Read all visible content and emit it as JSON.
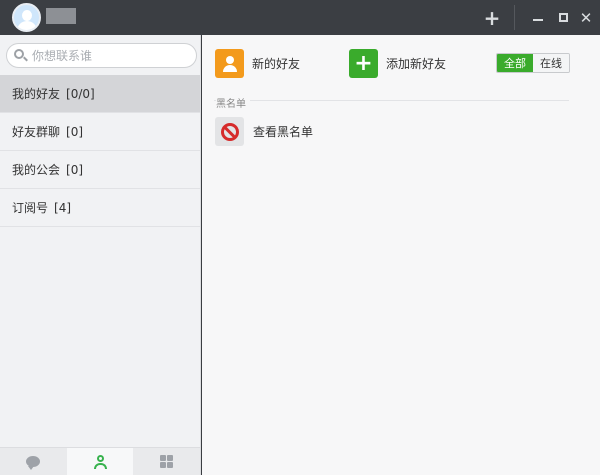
{
  "titlebar": {
    "add_glyph": "+",
    "close_glyph": "✕"
  },
  "sidebar": {
    "search_placeholder": "你想联系谁",
    "items": [
      {
        "label": "我的好友",
        "count": "[0/0]"
      },
      {
        "label": "好友群聊",
        "count": "[0]"
      },
      {
        "label": "我的公会",
        "count": "[0]"
      },
      {
        "label": "订阅号",
        "count": "[4]"
      }
    ],
    "bottom_tabs": [
      "chat-icon",
      "contacts-icon",
      "apps-icon"
    ]
  },
  "main": {
    "new_friend_label": "新的好友",
    "add_friend_label": "添加新好友",
    "add_glyph": "+",
    "filter": {
      "all": "全部",
      "online": "在线"
    },
    "section_title": "黑名单",
    "blacklist_label": "查看黑名单"
  },
  "colors": {
    "titlebar": "#3b3e43",
    "accent_green": "#3aab2c",
    "orange": "#f39a1c",
    "red": "#d62b2b"
  }
}
